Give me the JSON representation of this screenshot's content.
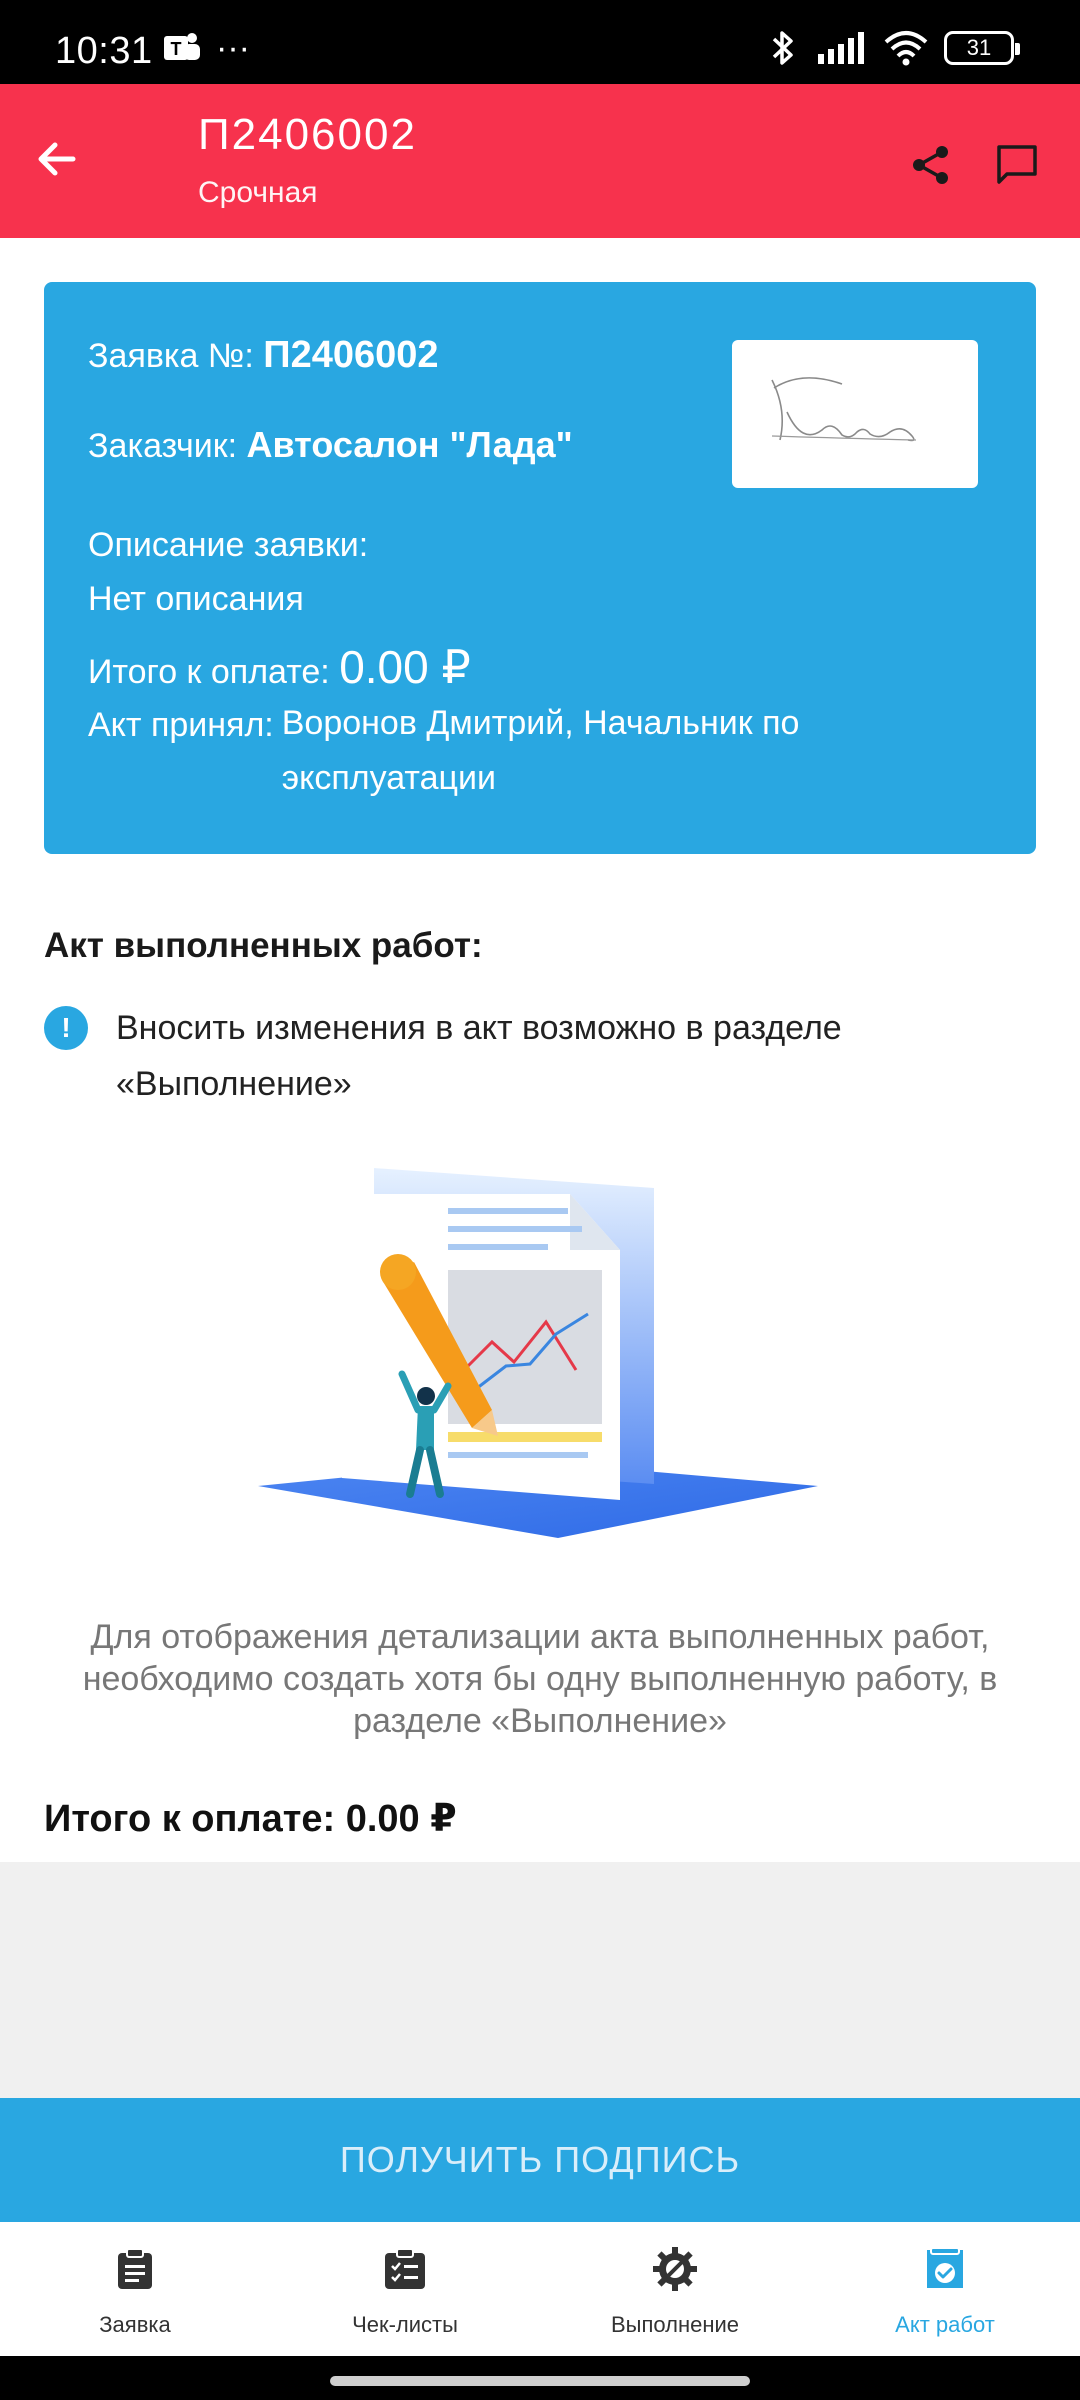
{
  "status_bar": {
    "time": "10:31",
    "more": "···",
    "battery": "31",
    "icons": [
      "teams-icon",
      "bluetooth-icon",
      "signal-icon",
      "wifi-icon",
      "battery-icon"
    ]
  },
  "app_bar": {
    "title": "П2406002",
    "subtitle": "Срочная",
    "color": "#f7324d"
  },
  "info": {
    "number_label": "Заявка №: ",
    "number_value": "П2406002",
    "customer_label": "Заказчик: ",
    "customer_value": "Автосалон \"Лада\"",
    "description_label": "Описание заявки:",
    "description_value": "Нет описания",
    "total_label": "Итого к оплате: ",
    "total_value": "0.00 ₽",
    "accepted_label": "Акт принял: ",
    "accepted_value": "Воронов Дмитрий, Начальник по эксплуатации",
    "card_color": "#29a7e1"
  },
  "act": {
    "title": "Акт выполненных работ:",
    "notice": "Вносить изменения в акт возможно в разделе «Выполнение»",
    "empty_hint": "Для отображения детализации акта выполненных работ, необходимо создать хотя бы одну выполненную работу, в разделе «Выполнение»",
    "total": "Итого к оплате: 0.00 ₽"
  },
  "sign_button": "ПОЛУЧИТЬ ПОДПИСЬ",
  "bottom_nav": [
    {
      "label": "Заявка",
      "icon": "clipboard-icon",
      "active": false
    },
    {
      "label": "Чек-листы",
      "icon": "checklist-icon",
      "active": false
    },
    {
      "label": "Выполнение",
      "icon": "gear-wrench-icon",
      "active": false
    },
    {
      "label": "Акт работ",
      "icon": "act-check-icon",
      "active": true
    }
  ]
}
